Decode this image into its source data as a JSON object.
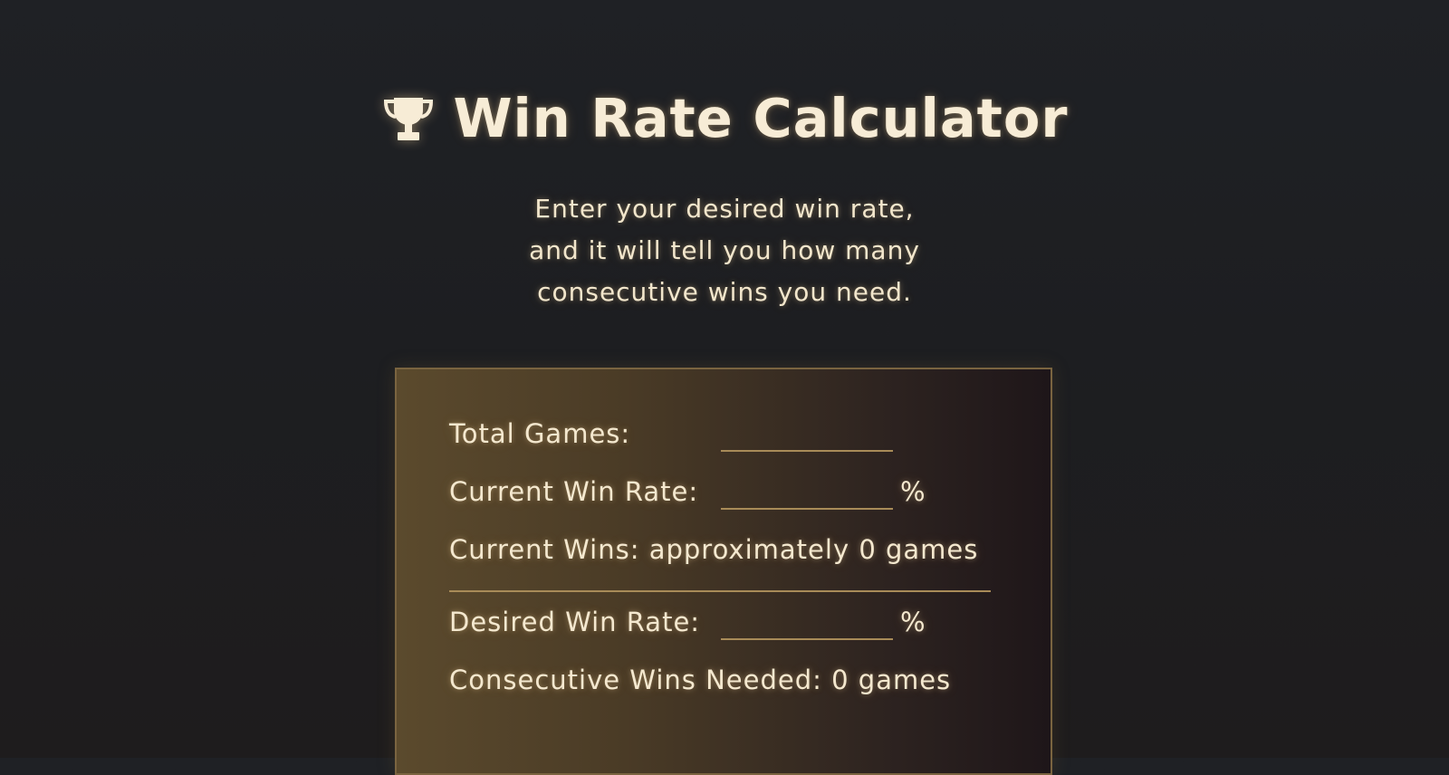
{
  "header": {
    "title": "Win Rate Calculator",
    "icon": "trophy-icon"
  },
  "subtitle": {
    "lines": [
      "Enter your desired win rate,",
      "and it will tell you how many",
      "consecutive wins you need."
    ]
  },
  "calculator": {
    "total_games_label": "Total Games:",
    "total_games_value": "",
    "current_win_rate_label": "Current Win Rate:",
    "current_win_rate_value": "",
    "current_win_rate_unit": "%",
    "current_wins_text": "Current Wins: approximately 0 games",
    "desired_win_rate_label": "Desired Win Rate:",
    "desired_win_rate_value": "",
    "desired_win_rate_unit": "%",
    "consecutive_wins_text": "Consecutive Wins Needed: 0 games"
  },
  "colors": {
    "background": "#1f2125",
    "text": "#f4e8cf",
    "panel_border": "#7a6440",
    "underline": "#a88b58"
  }
}
